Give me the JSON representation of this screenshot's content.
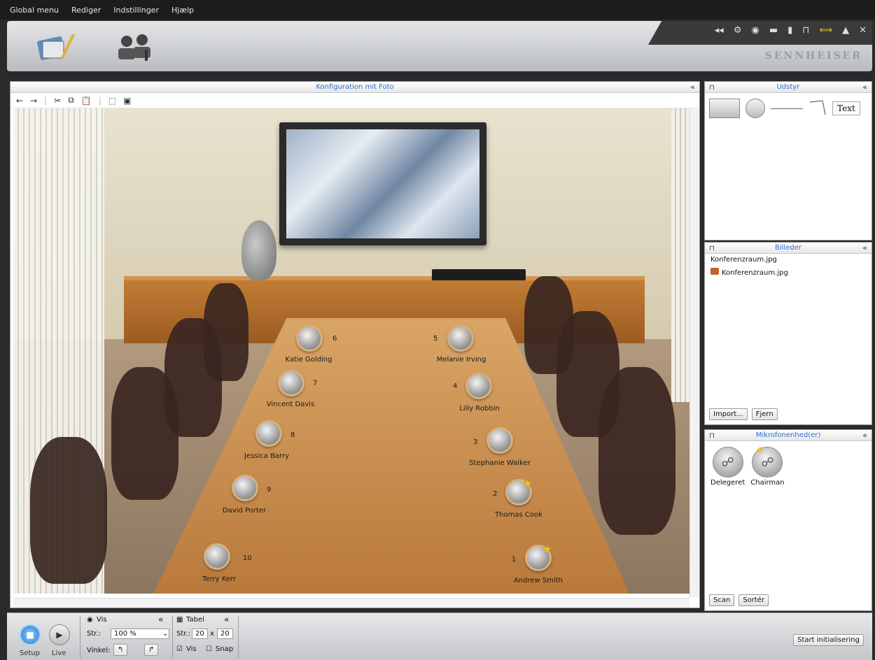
{
  "menu": [
    "Global menu",
    "Rediger",
    "Indstillinger",
    "Hjælp"
  ],
  "brand": "SENNHEISER",
  "main_panel": {
    "title": "Konfiguration mit Foto",
    "toolbar": [
      "back-icon",
      "forward-icon",
      "cut-icon",
      "copy-icon",
      "paste-icon",
      "select-icon",
      "layer-icon"
    ]
  },
  "seats": [
    {
      "num": "1",
      "name": "Andrew Smith",
      "chairman": true
    },
    {
      "num": "2",
      "name": "Thomas Cook",
      "chairman": true
    },
    {
      "num": "3",
      "name": "Stephanie Walker",
      "chairman": false
    },
    {
      "num": "4",
      "name": "Lilly Robbin",
      "chairman": false
    },
    {
      "num": "5",
      "name": "Melanie Irving",
      "chairman": false
    },
    {
      "num": "6",
      "name": "Katie Golding",
      "chairman": false
    },
    {
      "num": "7",
      "name": "Vincent Davis",
      "chairman": false
    },
    {
      "num": "8",
      "name": "Jessica Barry",
      "chairman": false
    },
    {
      "num": "9",
      "name": "David Porter",
      "chairman": false
    },
    {
      "num": "10",
      "name": "Terry Kerr",
      "chairman": false
    }
  ],
  "udstyr": {
    "title": "Udstyr",
    "text_tool": "Text"
  },
  "billeder": {
    "title": "Billeder",
    "items": [
      "Konferenzraum.jpg",
      "Konferenzraum.jpg"
    ],
    "import_label": "Import...",
    "remove_label": "Fjern"
  },
  "mikrofon": {
    "title": "Mikrofonenhed(er)",
    "devices": [
      "Delegeret",
      "Chairman"
    ],
    "scan_label": "Scan",
    "sort_label": "Sortér"
  },
  "bottom": {
    "setup_label": "Setup",
    "live_label": "Live",
    "vis": {
      "title": "Vis",
      "size_label": "Str.:",
      "size_value": "100 %",
      "angle_label": "Vinkel:"
    },
    "tabel": {
      "title": "Tabel",
      "size_label": "Str.:",
      "w": "20",
      "x": "x",
      "h": "20",
      "vis_label": "Vis",
      "snap_label": "Snap"
    },
    "start_label": "Start initialisering"
  }
}
